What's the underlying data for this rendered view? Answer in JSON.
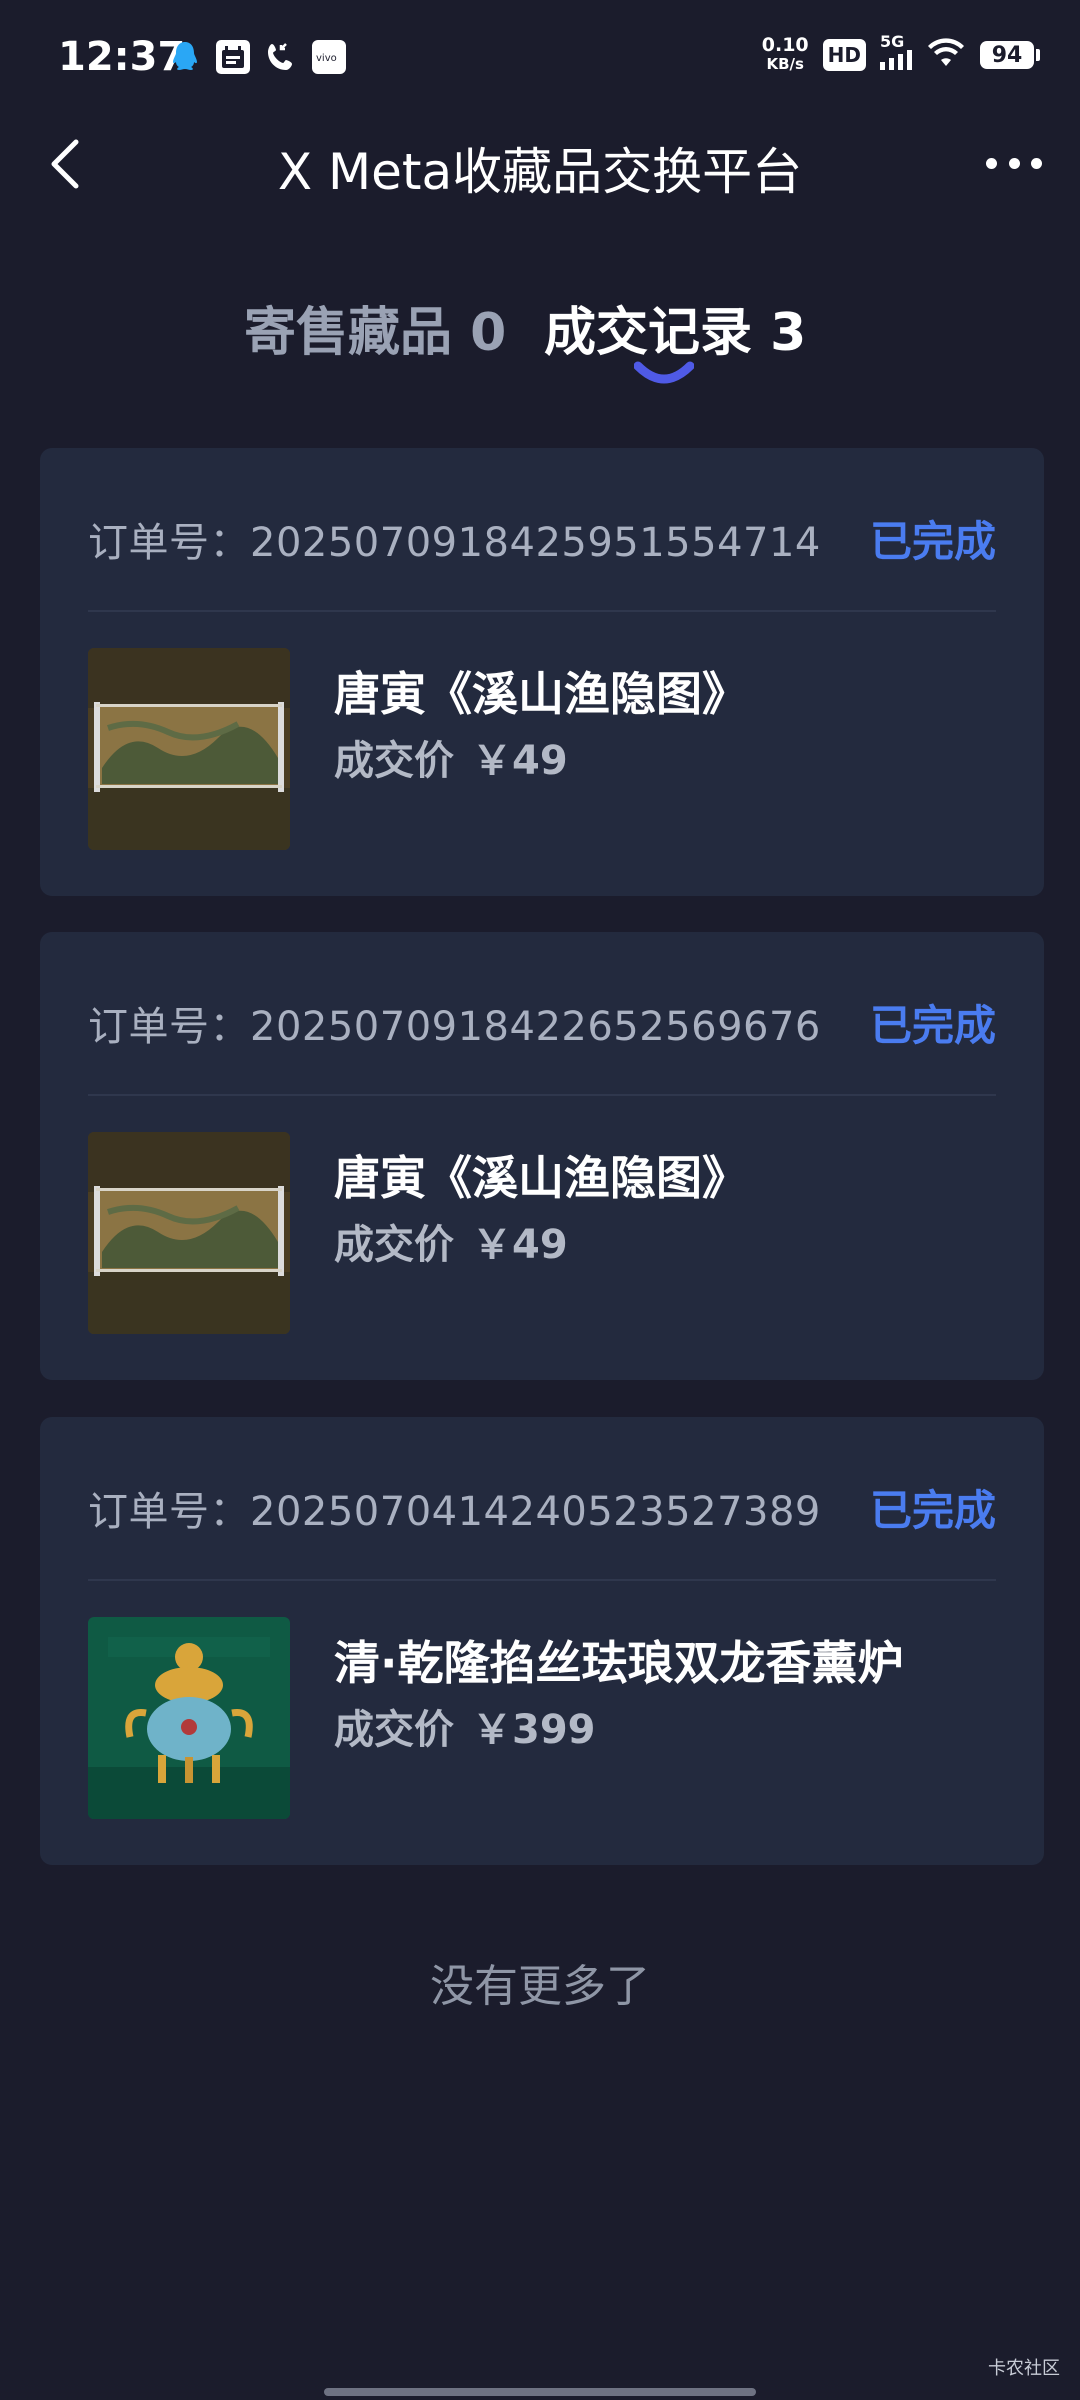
{
  "status_bar": {
    "time": "12:37",
    "net_speed_value": "0.10",
    "net_speed_unit": "KB/s",
    "hd": "HD",
    "network": "5G",
    "battery": "94"
  },
  "nav": {
    "title": "X Meta收藏品交换平台"
  },
  "tabs": [
    {
      "label": "寄售藏品 0",
      "active": false
    },
    {
      "label": "成交记录 3",
      "active": true
    }
  ],
  "orders": [
    {
      "order_label": "订单号：2025070918425951554714",
      "status": "已完成",
      "item_name": "唐寅《溪山渔隐图》",
      "price_label": "成交价",
      "price": "￥49",
      "thumb_icon": "scroll-painting-thumbnail"
    },
    {
      "order_label": "订单号：2025070918422652569676",
      "status": "已完成",
      "item_name": "唐寅《溪山渔隐图》",
      "price_label": "成交价",
      "price": "￥49",
      "thumb_icon": "scroll-painting-thumbnail"
    },
    {
      "order_label": "订单号：2025070414240523527389",
      "status": "已完成",
      "item_name": "清·乾隆掐丝珐琅双龙香薰炉",
      "price_label": "成交价",
      "price": "￥399",
      "thumb_icon": "incense-burner-thumbnail"
    }
  ],
  "footer": {
    "no_more": "没有更多了",
    "watermark": "卡农社区"
  },
  "colors": {
    "background": "#1b1c2c",
    "card": "#232a3e",
    "accent": "#4a7cf0"
  }
}
